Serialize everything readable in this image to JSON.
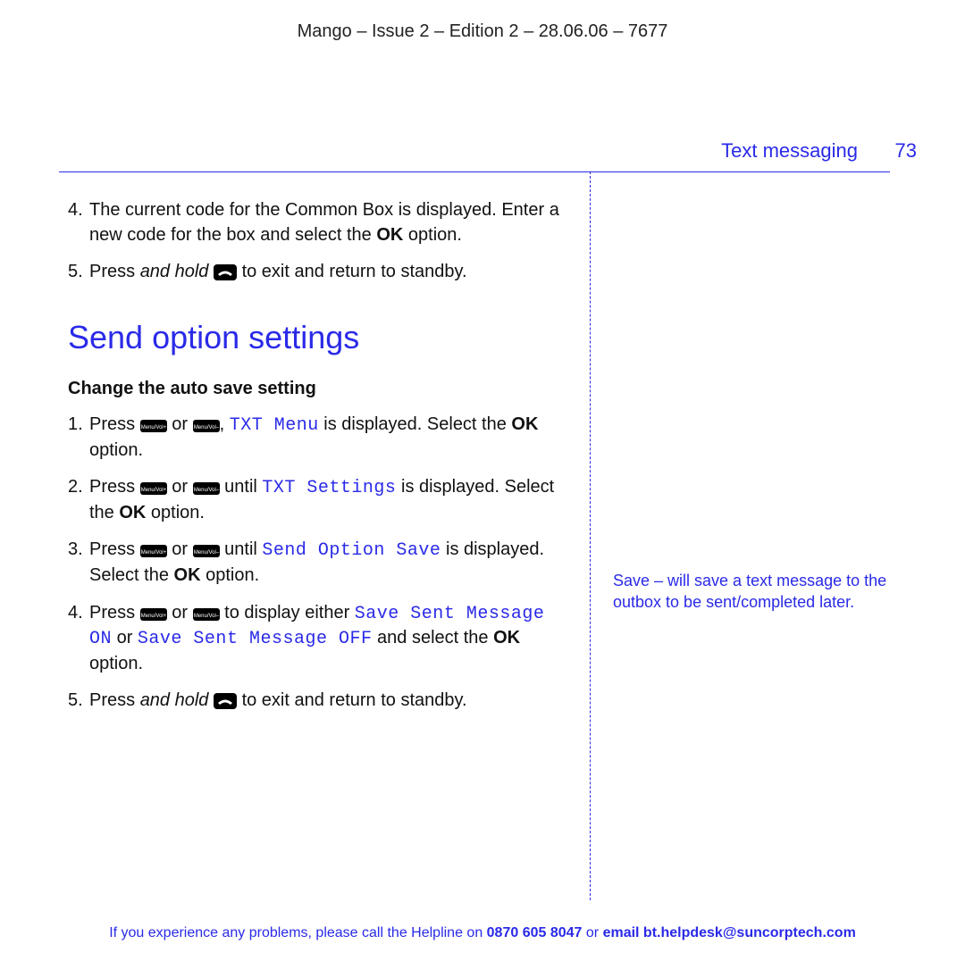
{
  "header": "Mango – Issue 2 – Edition 2 – 28.06.06 – 7677",
  "section_label": "Text messaging",
  "page_number": "73",
  "prev_steps": {
    "s4_a": "The current code for the Common Box is displayed. Enter a new code for the box and select the ",
    "s4_ok": "OK",
    "s4_b": " option.",
    "s5_a": "Press ",
    "s5_hold": "and hold",
    "s5_b": " to exit and return to standby."
  },
  "section_heading": "Send option settings",
  "sub_heading": "Change the auto save setting",
  "auto_save_steps": {
    "s1_a": "Press ",
    "s1_or": " or ",
    "s1_comma": ", ",
    "s1_txtmenu": "TXT Menu",
    "s1_b": " is displayed. Select the ",
    "s1_ok": "OK",
    "s1_c": " option.",
    "s2_a": "Press ",
    "s2_or": " or ",
    "s2_until": " until ",
    "s2_txtsettings": "TXT Settings",
    "s2_b": " is displayed. Select the ",
    "s2_ok": "OK",
    "s2_c": " option.",
    "s3_a": "Press ",
    "s3_or": " or ",
    "s3_until": " until ",
    "s3_sendopt": "Send Option Save",
    "s3_b": " is displayed. Select the ",
    "s3_ok": "OK",
    "s3_c": " option.",
    "s4_a": "Press ",
    "s4_or": " or ",
    "s4_b": " to display either ",
    "s4_on": "Save Sent Message ON",
    "s4_or2": " or ",
    "s4_off": "Save Sent Message OFF",
    "s4_c": " and select the ",
    "s4_ok": "OK",
    "s4_d": " option.",
    "s5_a": "Press ",
    "s5_hold": "and hold",
    "s5_b": " to exit and return to standby."
  },
  "side_note": "Save – will save a text message to the outbox to be sent/completed later.",
  "footer": {
    "a": "If you experience any problems, please call the Helpline on ",
    "phone": "0870 605 8047",
    "b": " or ",
    "email_label": "email bt.helpdesk@suncorptech.com"
  }
}
